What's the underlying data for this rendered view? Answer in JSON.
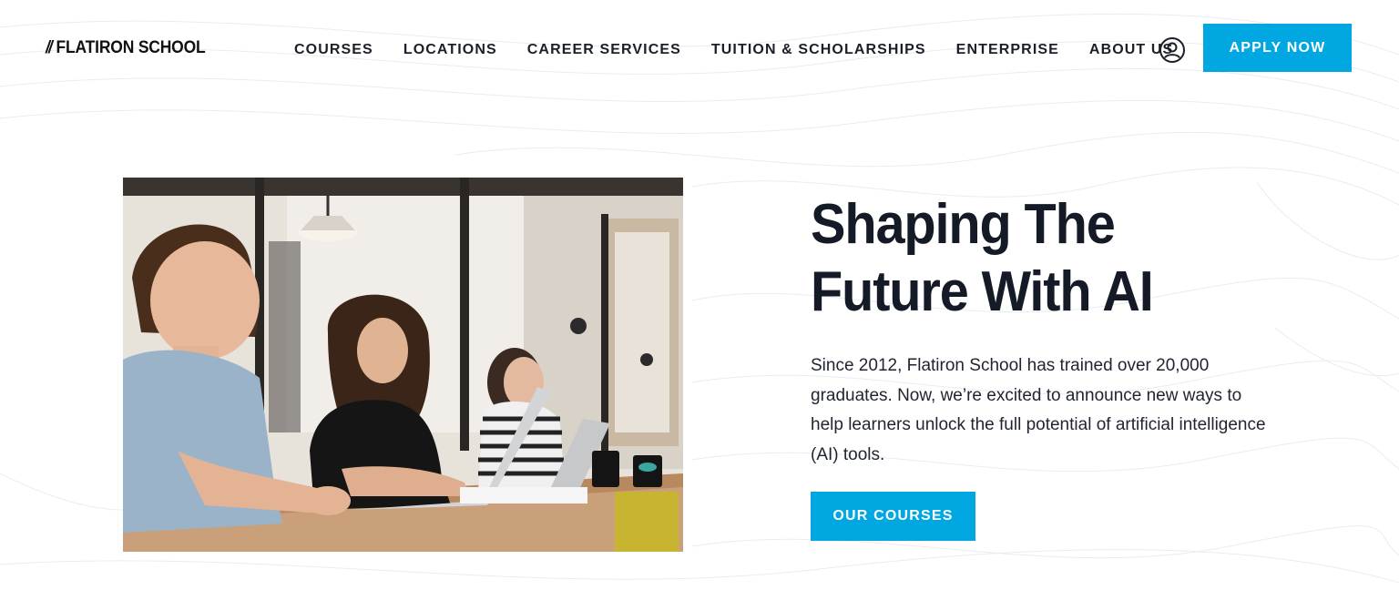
{
  "header": {
    "logo_slashes": "//",
    "logo_text": "FLATIRON SCHOOL",
    "nav": [
      {
        "label": "COURSES"
      },
      {
        "label": "LOCATIONS"
      },
      {
        "label": "CAREER SERVICES"
      },
      {
        "label": "TUITION & SCHOLARSHIPS"
      },
      {
        "label": "ENTERPRISE"
      },
      {
        "label": "ABOUT US"
      }
    ],
    "account_icon": "user-circle-icon",
    "apply_label": "APPLY NOW"
  },
  "hero": {
    "title": "Shaping The Future With AI",
    "description": "Since 2012, Flatiron School has trained over 20,000 graduates. Now, we’re excited to announce new ways to help learners unlock the full potential of artificial intelligence (AI) tools.",
    "cta_label": "OUR COURSES",
    "photo_subject": "students-at-laptops-photo"
  },
  "colors": {
    "accent": "#00A7E1",
    "heading": "#141A26",
    "background": "#FFFFFF"
  }
}
